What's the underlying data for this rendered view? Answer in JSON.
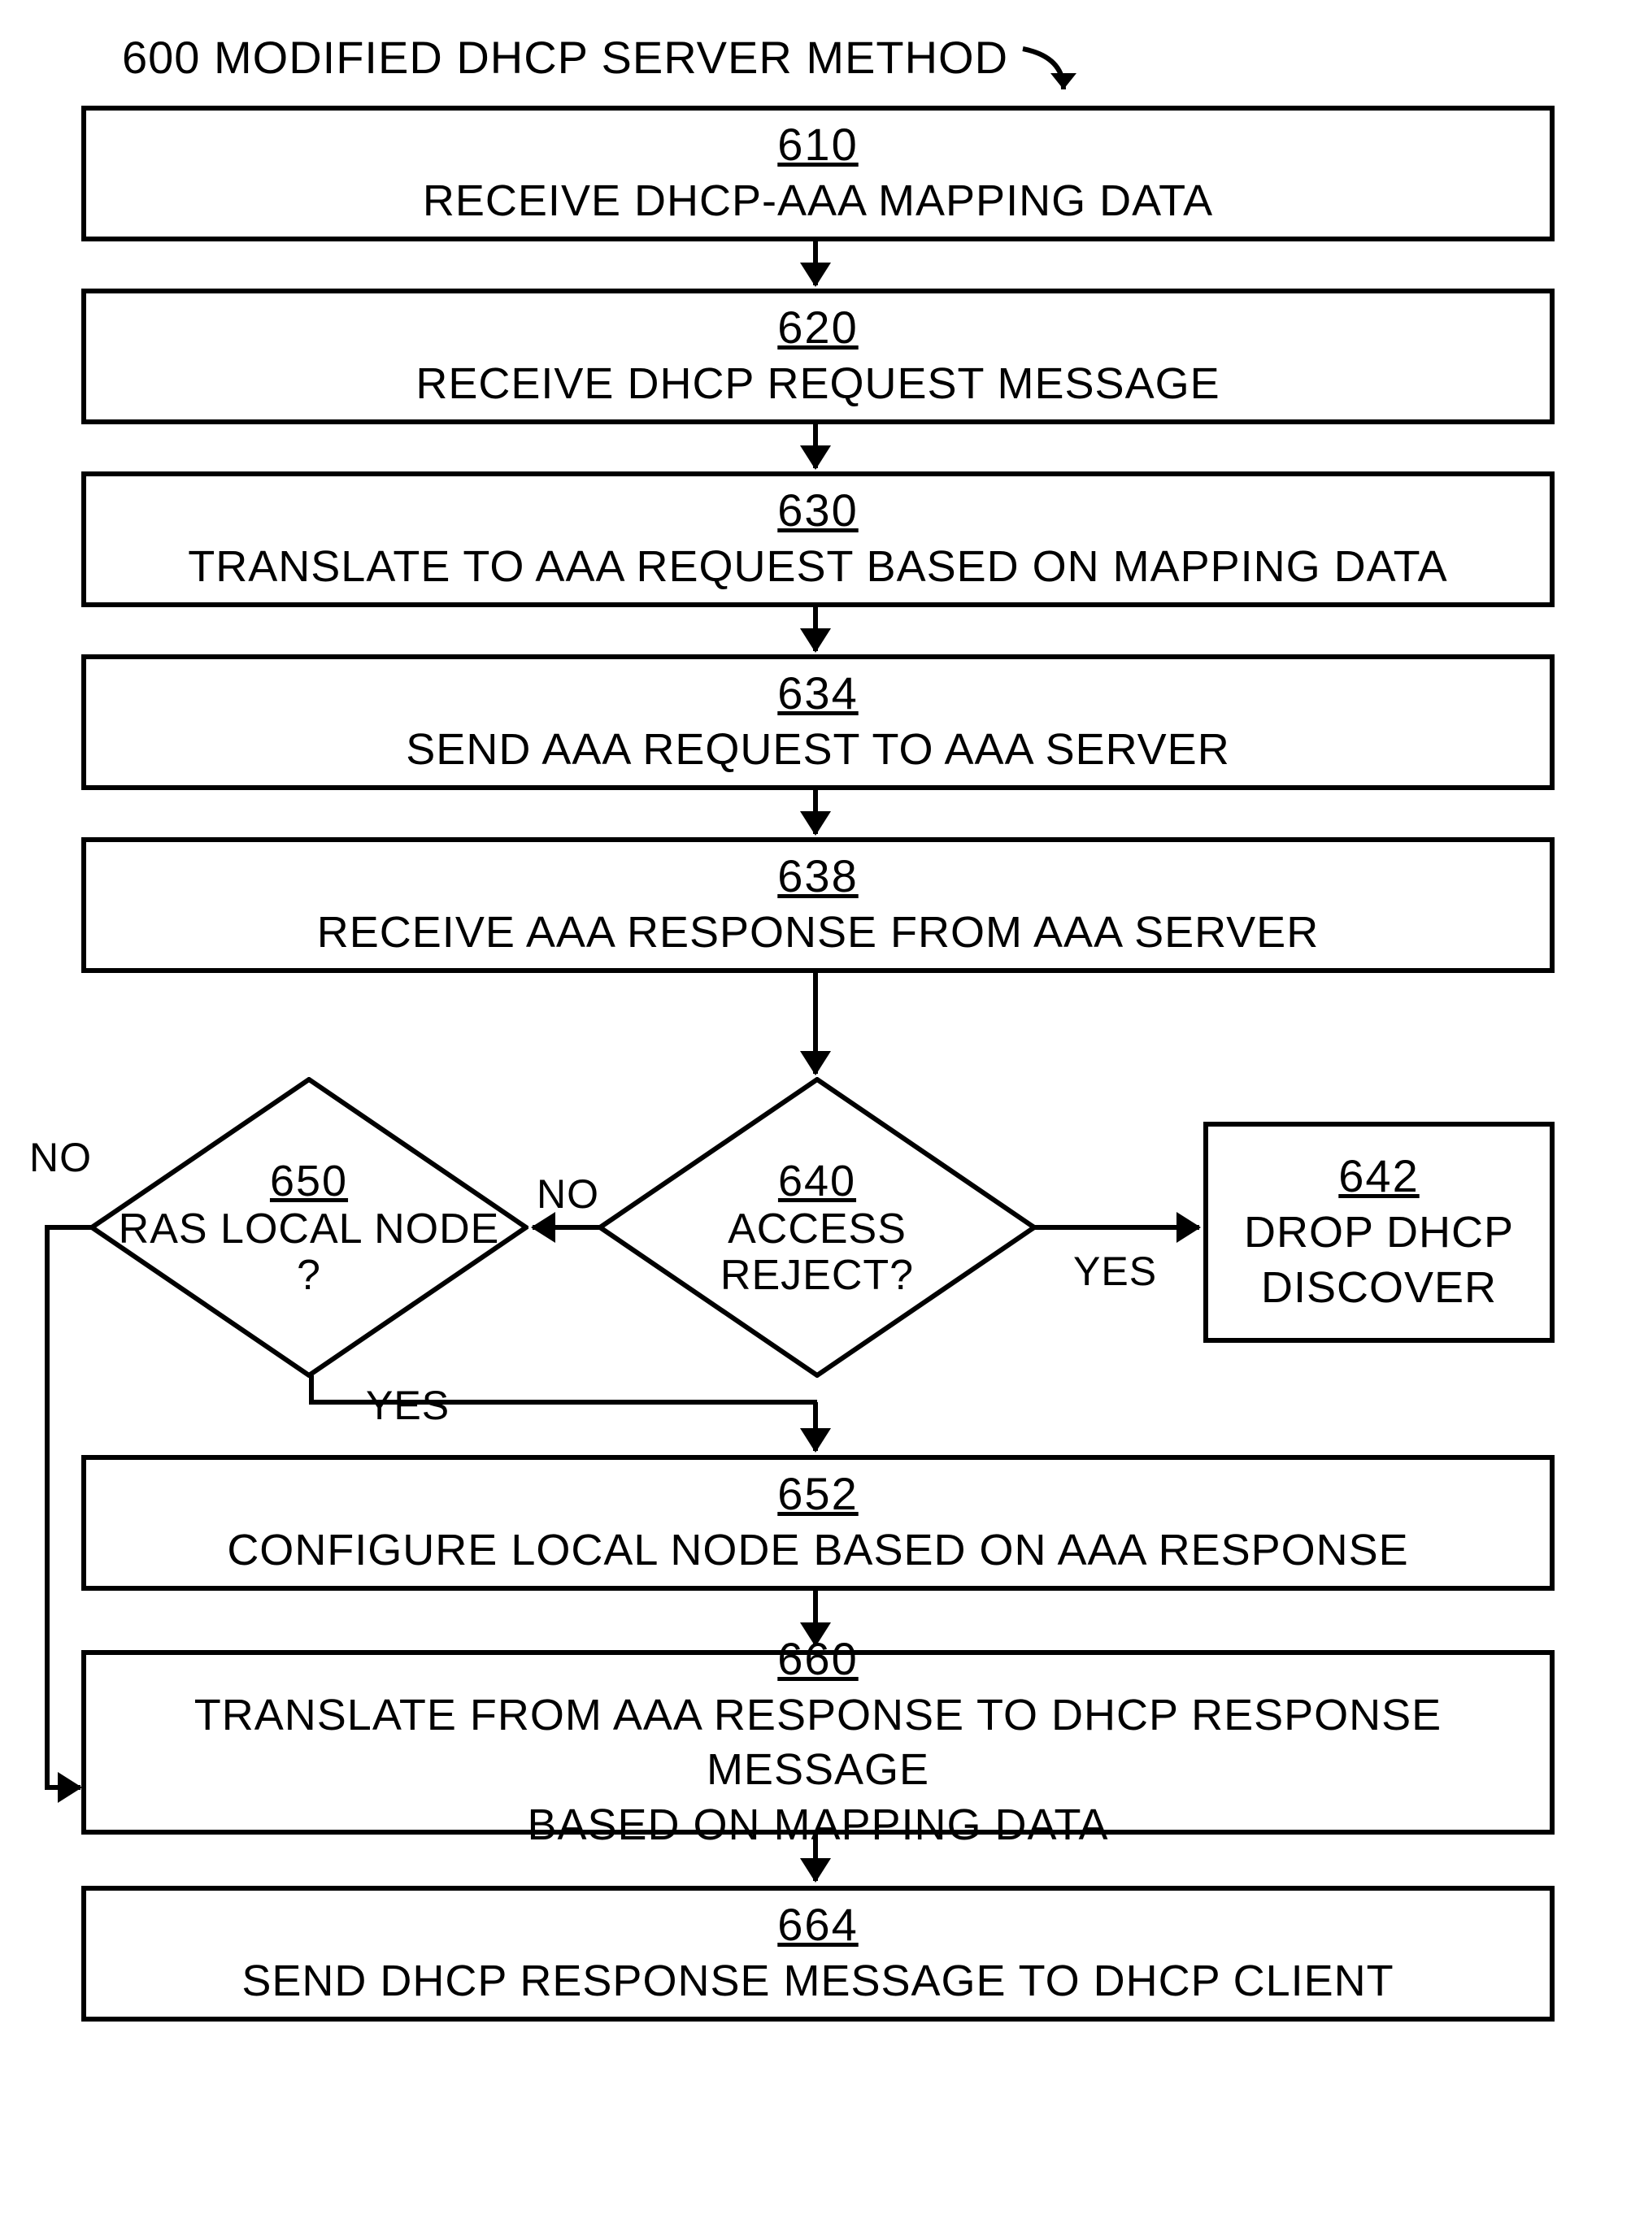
{
  "title": "600 MODIFIED DHCP SERVER METHOD",
  "steps": {
    "s610": {
      "num": "610",
      "txt": "RECEIVE DHCP-AAA MAPPING DATA"
    },
    "s620": {
      "num": "620",
      "txt": "RECEIVE DHCP REQUEST MESSAGE"
    },
    "s630": {
      "num": "630",
      "txt": "TRANSLATE TO AAA REQUEST BASED ON MAPPING DATA"
    },
    "s634": {
      "num": "634",
      "txt": "SEND AAA REQUEST TO AAA SERVER"
    },
    "s638": {
      "num": "638",
      "txt": "RECEIVE AAA RESPONSE FROM AAA SERVER"
    },
    "s640": {
      "num": "640",
      "txt": "ACCESS\nREJECT?"
    },
    "s642": {
      "num": "642",
      "txt": "DROP DHCP\nDISCOVER"
    },
    "s650": {
      "num": "650",
      "txt": "RAS LOCAL NODE\n?"
    },
    "s652": {
      "num": "652",
      "txt": "CONFIGURE LOCAL NODE BASED ON AAA RESPONSE"
    },
    "s660": {
      "num": "660",
      "txt": "TRANSLATE FROM  AAA RESPONSE TO DHCP RESPONSE MESSAGE\nBASED ON MAPPING DATA"
    },
    "s664": {
      "num": "664",
      "txt": "SEND DHCP RESPONSE MESSAGE TO DHCP CLIENT"
    }
  },
  "labels": {
    "no1": "NO",
    "yes1": "YES",
    "no2": "NO",
    "yes2": "YES"
  }
}
